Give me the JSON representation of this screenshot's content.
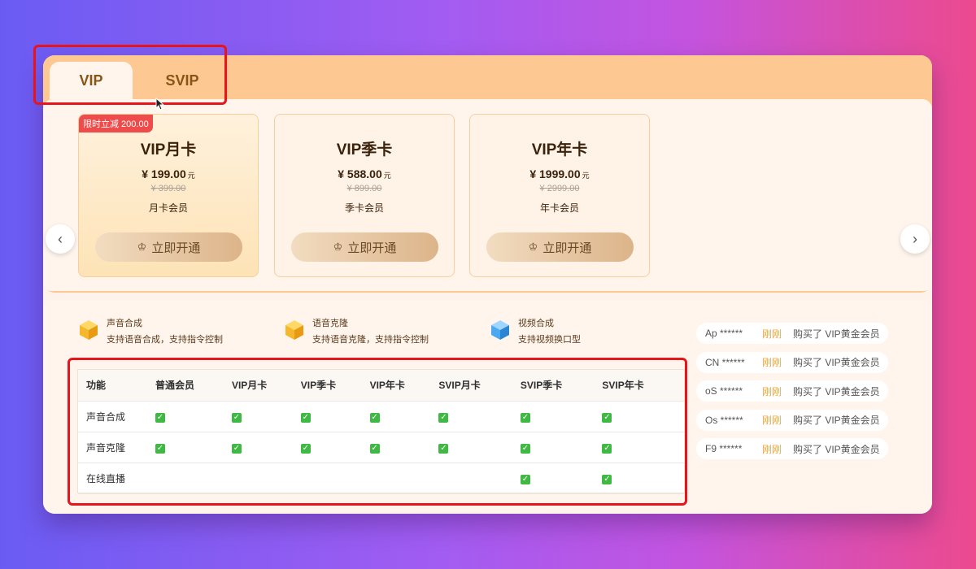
{
  "tabs": [
    {
      "label": "VIP",
      "active": true
    },
    {
      "label": "SVIP",
      "active": false
    }
  ],
  "cards": [
    {
      "badge": "限时立减 200.00",
      "name": "VIP月卡",
      "price": "¥ 199.00",
      "unit": "元",
      "old_price": "¥ 399.00",
      "desc": "月卡会员",
      "button": "立即开通",
      "selected": true
    },
    {
      "badge": "",
      "name": "VIP季卡",
      "price": "¥ 588.00",
      "unit": "元",
      "old_price": "¥ 899.00",
      "desc": "季卡会员",
      "button": "立即开通",
      "selected": false
    },
    {
      "badge": "",
      "name": "VIP年卡",
      "price": "¥ 1999.00",
      "unit": "元",
      "old_price": "¥ 2999.00",
      "desc": "年卡会员",
      "button": "立即开通",
      "selected": false
    }
  ],
  "nav": {
    "prev": "‹",
    "next": "›"
  },
  "features": [
    {
      "title": "声音合成",
      "desc": "支持语音合成，支持指令控制",
      "color": "#f5b82c"
    },
    {
      "title": "语音克隆",
      "desc": "支持语音克隆，支持指令控制",
      "color": "#f5b82c"
    },
    {
      "title": "视频合成",
      "desc": "支持视频换口型",
      "color": "#4aa9f0"
    }
  ],
  "comparison": {
    "headers": [
      "功能",
      "普通会员",
      "VIP月卡",
      "VIP季卡",
      "VIP年卡",
      "SVIP月卡",
      "SVIP季卡",
      "SVIP年卡"
    ],
    "rows": [
      {
        "feature": "声音合成",
        "checks": [
          true,
          true,
          true,
          true,
          true,
          true,
          true
        ]
      },
      {
        "feature": "声音克隆",
        "checks": [
          true,
          true,
          true,
          true,
          true,
          true,
          true
        ]
      },
      {
        "feature": "在线直播",
        "checks": [
          false,
          false,
          false,
          false,
          false,
          true,
          true
        ]
      }
    ]
  },
  "purchases": [
    {
      "user": "Ap ******",
      "time": "刚刚",
      "action": "购买了 VIP黄金会员"
    },
    {
      "user": "CN ******",
      "time": "刚刚",
      "action": "购买了 VIP黄金会员"
    },
    {
      "user": "oS ******",
      "time": "刚刚",
      "action": "购买了 VIP黄金会员"
    },
    {
      "user": "Os ******",
      "time": "刚刚",
      "action": "购买了 VIP黄金会员"
    },
    {
      "user": "F9 ******",
      "time": "刚刚",
      "action": "购买了 VIP黄金会员"
    }
  ],
  "colors": {
    "accent": "#fdc892",
    "highlight": "#e8141b",
    "check": "#3fb844",
    "badge": "#ef4b4b"
  }
}
